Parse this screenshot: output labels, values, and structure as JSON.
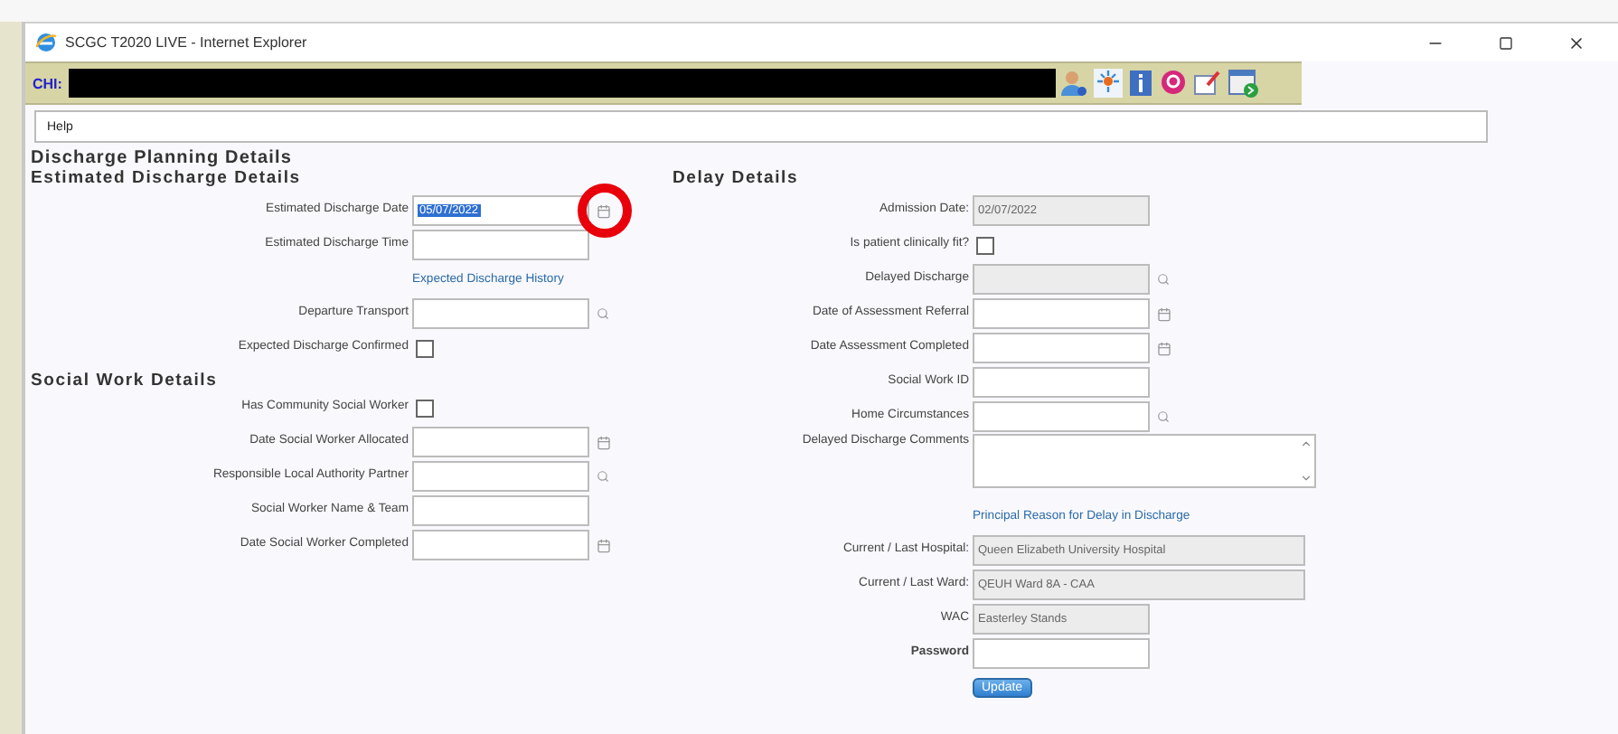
{
  "window": {
    "title": "SCGC T2020 LIVE - Internet Explorer"
  },
  "patient_bar": {
    "label": "CHI:",
    "redacted": true
  },
  "menu": [
    {
      "label": "Help"
    }
  ],
  "page_title": "Discharge Planning Details",
  "left_sections": [
    {
      "heading": "Estimated Discharge Details",
      "fields": [
        {
          "kind": "input",
          "label": "Estimated Discharge Date",
          "value": "05/07/2022",
          "highlighted": true,
          "calendar": true,
          "circled": true
        },
        {
          "kind": "input",
          "label": "Estimated Discharge Time"
        },
        {
          "kind": "link",
          "label": "Expected Discharge History"
        },
        {
          "kind": "input",
          "label": "Departure Transport",
          "lookup": true
        },
        {
          "kind": "checkbox",
          "label": "Expected Discharge Confirmed",
          "checked": false
        }
      ]
    },
    {
      "heading": "Social Work Details",
      "fields": [
        {
          "kind": "checkbox",
          "label": "Has Community Social Worker",
          "checked": false
        },
        {
          "kind": "input",
          "label": "Date Social Worker Allocated",
          "calendar": true
        },
        {
          "kind": "input",
          "label": "Responsible Local Authority Partner",
          "lookup": true
        },
        {
          "kind": "input",
          "label": "Social Worker Name & Team"
        },
        {
          "kind": "input",
          "label": "Date Social Worker Completed",
          "calendar": true
        }
      ]
    }
  ],
  "right_section": {
    "heading": "Delay Details",
    "fields": [
      {
        "kind": "input",
        "label": "Admission Date:",
        "value": "02/07/2022",
        "readonly": true
      },
      {
        "kind": "checkbox",
        "label": "Is patient clinically fit?",
        "checked": false
      },
      {
        "kind": "input",
        "label": "Delayed Discharge",
        "readonly": true,
        "lookup": true
      },
      {
        "kind": "input",
        "label": "Date of Assessment Referral",
        "calendar": true
      },
      {
        "kind": "input",
        "label": "Date Assessment Completed",
        "calendar": true
      },
      {
        "kind": "input",
        "label": "Social Work ID"
      },
      {
        "kind": "input",
        "label": "Home Circumstances",
        "lookup": true
      },
      {
        "kind": "textarea",
        "label": "Delayed Discharge Comments"
      },
      {
        "kind": "link",
        "label": "Principal Reason for Delay in Discharge"
      },
      {
        "kind": "input",
        "label": "Current / Last Hospital:",
        "value": "Queen Elizabeth University Hospital",
        "readonly": true,
        "wide": true
      },
      {
        "kind": "input",
        "label": "Current / Last Ward:",
        "value": "QEUH Ward 8A - CAA",
        "readonly": true,
        "wide": true
      },
      {
        "kind": "input",
        "label": "WAC",
        "value": "Easterley Stands",
        "readonly": true
      },
      {
        "kind": "input",
        "label": "Password",
        "emphasis": true
      },
      {
        "kind": "button",
        "label": "Update"
      }
    ]
  }
}
